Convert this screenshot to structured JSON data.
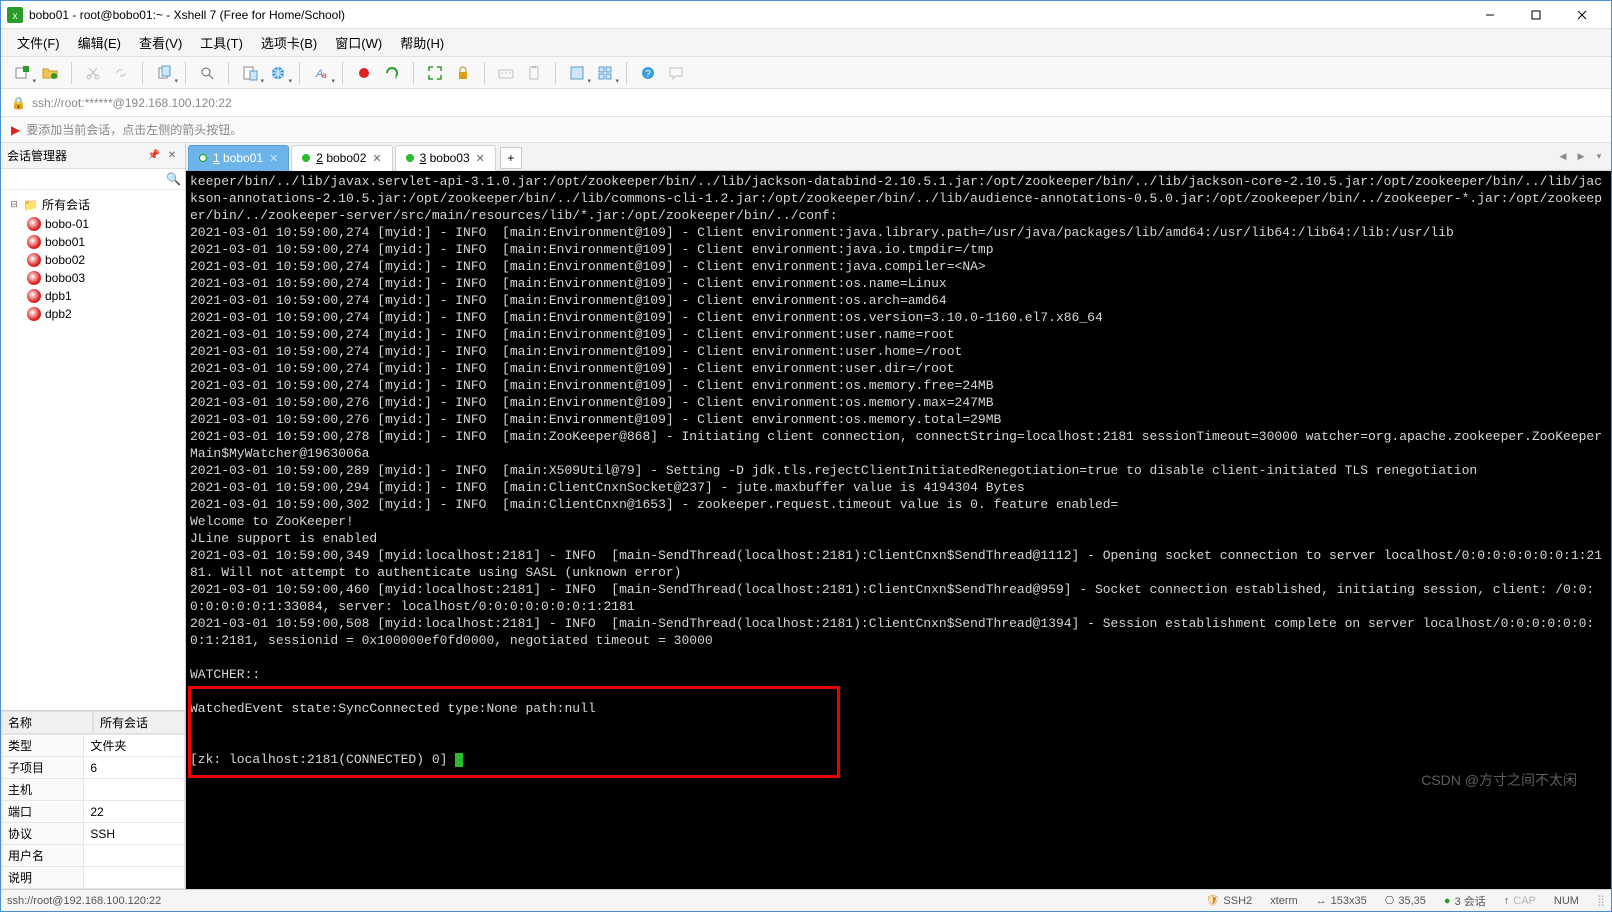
{
  "window": {
    "title": "bobo01 - root@bobo01:~ - Xshell 7 (Free for Home/School)"
  },
  "menus": [
    "文件(F)",
    "编辑(E)",
    "查看(V)",
    "工具(T)",
    "选项卡(B)",
    "窗口(W)",
    "帮助(H)"
  ],
  "address": {
    "url": "ssh://root:******@192.168.100.120:22"
  },
  "hint": "要添加当前会话，点击左侧的箭头按钮。",
  "session_panel": {
    "title": "会话管理器",
    "search_placeholder": ""
  },
  "tree": {
    "root": "所有会话",
    "children": [
      "bobo-01",
      "bobo01",
      "bobo02",
      "bobo03",
      "dpb1",
      "dpb2"
    ]
  },
  "props": {
    "headers": [
      "名称",
      "所有会话"
    ],
    "rows": [
      {
        "k": "类型",
        "v": "文件夹"
      },
      {
        "k": "子项目",
        "v": "6"
      },
      {
        "k": "主机",
        "v": ""
      },
      {
        "k": "端口",
        "v": "22"
      },
      {
        "k": "协议",
        "v": "SSH"
      },
      {
        "k": "用户名",
        "v": ""
      },
      {
        "k": "说明",
        "v": ""
      }
    ]
  },
  "tabs": [
    {
      "num": "1",
      "label": "bobo01",
      "active": true
    },
    {
      "num": "2",
      "label": "bobo02",
      "active": false
    },
    {
      "num": "3",
      "label": "bobo03",
      "active": false
    }
  ],
  "terminal_lines": [
    "keeper/bin/../lib/javax.servlet-api-3.1.0.jar:/opt/zookeeper/bin/../lib/jackson-databind-2.10.5.1.jar:/opt/zookeeper/bin/../lib/jackson-core-2.10.5.jar:/opt/zookeeper/bin/../lib/jackson-annotations-2.10.5.jar:/opt/zookeeper/bin/../lib/commons-cli-1.2.jar:/opt/zookeeper/bin/../lib/audience-annotations-0.5.0.jar:/opt/zookeeper/bin/../zookeeper-*.jar:/opt/zookeeper/bin/../zookeeper-server/src/main/resources/lib/*.jar:/opt/zookeeper/bin/../conf:",
    "2021-03-01 10:59:00,274 [myid:] - INFO  [main:Environment@109] - Client environment:java.library.path=/usr/java/packages/lib/amd64:/usr/lib64:/lib64:/lib:/usr/lib",
    "2021-03-01 10:59:00,274 [myid:] - INFO  [main:Environment@109] - Client environment:java.io.tmpdir=/tmp",
    "2021-03-01 10:59:00,274 [myid:] - INFO  [main:Environment@109] - Client environment:java.compiler=<NA>",
    "2021-03-01 10:59:00,274 [myid:] - INFO  [main:Environment@109] - Client environment:os.name=Linux",
    "2021-03-01 10:59:00,274 [myid:] - INFO  [main:Environment@109] - Client environment:os.arch=amd64",
    "2021-03-01 10:59:00,274 [myid:] - INFO  [main:Environment@109] - Client environment:os.version=3.10.0-1160.el7.x86_64",
    "2021-03-01 10:59:00,274 [myid:] - INFO  [main:Environment@109] - Client environment:user.name=root",
    "2021-03-01 10:59:00,274 [myid:] - INFO  [main:Environment@109] - Client environment:user.home=/root",
    "2021-03-01 10:59:00,274 [myid:] - INFO  [main:Environment@109] - Client environment:user.dir=/root",
    "2021-03-01 10:59:00,274 [myid:] - INFO  [main:Environment@109] - Client environment:os.memory.free=24MB",
    "2021-03-01 10:59:00,276 [myid:] - INFO  [main:Environment@109] - Client environment:os.memory.max=247MB",
    "2021-03-01 10:59:00,276 [myid:] - INFO  [main:Environment@109] - Client environment:os.memory.total=29MB",
    "2021-03-01 10:59:00,278 [myid:] - INFO  [main:ZooKeeper@868] - Initiating client connection, connectString=localhost:2181 sessionTimeout=30000 watcher=org.apache.zookeeper.ZooKeeperMain$MyWatcher@1963006a",
    "2021-03-01 10:59:00,289 [myid:] - INFO  [main:X509Util@79] - Setting -D jdk.tls.rejectClientInitiatedRenegotiation=true to disable client-initiated TLS renegotiation",
    "2021-03-01 10:59:00,294 [myid:] - INFO  [main:ClientCnxnSocket@237] - jute.maxbuffer value is 4194304 Bytes",
    "2021-03-01 10:59:00,302 [myid:] - INFO  [main:ClientCnxn@1653] - zookeeper.request.timeout value is 0. feature enabled=",
    "Welcome to ZooKeeper!",
    "JLine support is enabled",
    "2021-03-01 10:59:00,349 [myid:localhost:2181] - INFO  [main-SendThread(localhost:2181):ClientCnxn$SendThread@1112] - Opening socket connection to server localhost/0:0:0:0:0:0:0:1:2181. Will not attempt to authenticate using SASL (unknown error)",
    "2021-03-01 10:59:00,460 [myid:localhost:2181] - INFO  [main-SendThread(localhost:2181):ClientCnxn$SendThread@959] - Socket connection established, initiating session, client: /0:0:0:0:0:0:0:1:33084, server: localhost/0:0:0:0:0:0:0:1:2181",
    "2021-03-01 10:59:00,508 [myid:localhost:2181] - INFO  [main-SendThread(localhost:2181):ClientCnxn$SendThread@1394] - Session establishment complete on server localhost/0:0:0:0:0:0:0:1:2181, sessionid = 0x100000ef0fd0000, negotiated timeout = 30000",
    "",
    "WATCHER::",
    "",
    "WatchedEvent state:SyncConnected type:None path:null"
  ],
  "terminal_prompt": "[zk: localhost:2181(CONNECTED) 0] ",
  "watermark": "CSDN @方寸之间不太闲",
  "status": {
    "left": "ssh://root@192.168.100.120:22",
    "ssh": "SSH2",
    "term": "xterm",
    "size": "153x35",
    "cursor": "35,35",
    "sessions": "3 会话",
    "caps": "CAP",
    "num": "NUM"
  }
}
